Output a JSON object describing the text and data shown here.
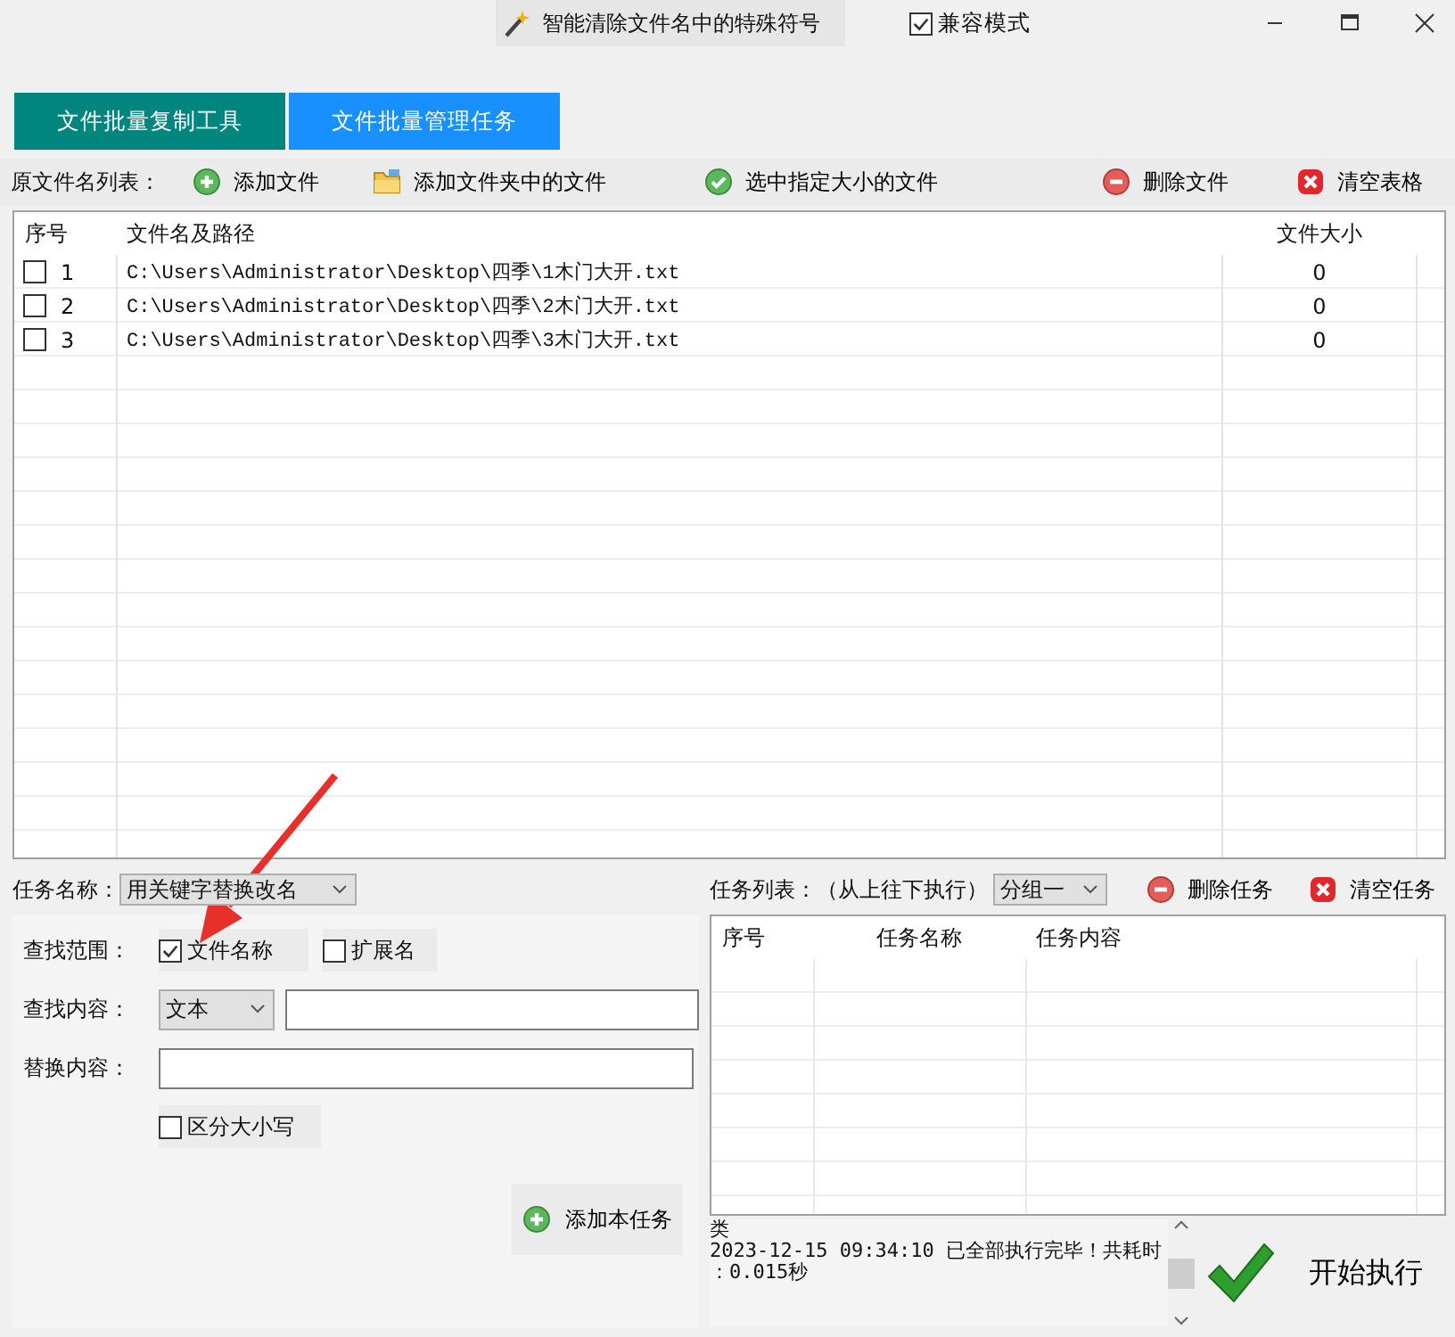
{
  "window": {
    "title": "智能清除文件名中的特殊符号",
    "compat_mode": {
      "label": "兼容模式",
      "checked": true
    }
  },
  "tabs": [
    {
      "label": "文件批量复制工具",
      "selected": false
    },
    {
      "label": "文件批量管理任务",
      "selected": true
    }
  ],
  "file_toolbar": {
    "label": "原文件名列表：",
    "buttons": [
      {
        "label": "添加文件",
        "kind": "add"
      },
      {
        "label": "添加文件夹中的文件",
        "kind": "folder"
      },
      {
        "label": "选中指定大小的文件",
        "kind": "check"
      },
      {
        "label": "删除文件",
        "kind": "remove"
      },
      {
        "label": "清空表格",
        "kind": "clear"
      }
    ]
  },
  "file_table": {
    "columns": [
      "序号",
      "文件名及路径",
      "文件大小"
    ],
    "rows": [
      {
        "checked": false,
        "index": "1",
        "path": "C:\\Users\\Administrator\\Desktop\\四季\\1木门大开.txt",
        "size": "0"
      },
      {
        "checked": false,
        "index": "2",
        "path": "C:\\Users\\Administrator\\Desktop\\四季\\2木门大开.txt",
        "size": "0"
      },
      {
        "checked": false,
        "index": "3",
        "path": "C:\\Users\\Administrator\\Desktop\\四季\\3木门大开.txt",
        "size": "0"
      }
    ]
  },
  "task_form": {
    "task_name_label": "任务名称：",
    "task_name": "用关键字替换改名",
    "scope_label": "查找范围：",
    "scope_options": [
      {
        "label": "文件名称",
        "checked": true
      },
      {
        "label": "扩展名",
        "checked": false
      }
    ],
    "find_label": "查找内容：",
    "find_type": "文本",
    "replace_label": "替换内容：",
    "case_option": {
      "label": "区分大小写",
      "checked": false
    },
    "add_button": "添加本任务"
  },
  "task_list": {
    "label": "任务列表：（从上往下执行）",
    "group": "分组一",
    "buttons": [
      {
        "label": "删除任务",
        "kind": "remove"
      },
      {
        "label": "清空任务",
        "kind": "clear"
      }
    ],
    "columns": [
      "序号",
      "任务名称",
      "任务内容"
    ]
  },
  "log": {
    "lines": [
      "类",
      "2023-12-15 09:34:10 已全部执行完毕！共耗时",
      "：0.015秒"
    ]
  },
  "start_button": "开始执行"
}
